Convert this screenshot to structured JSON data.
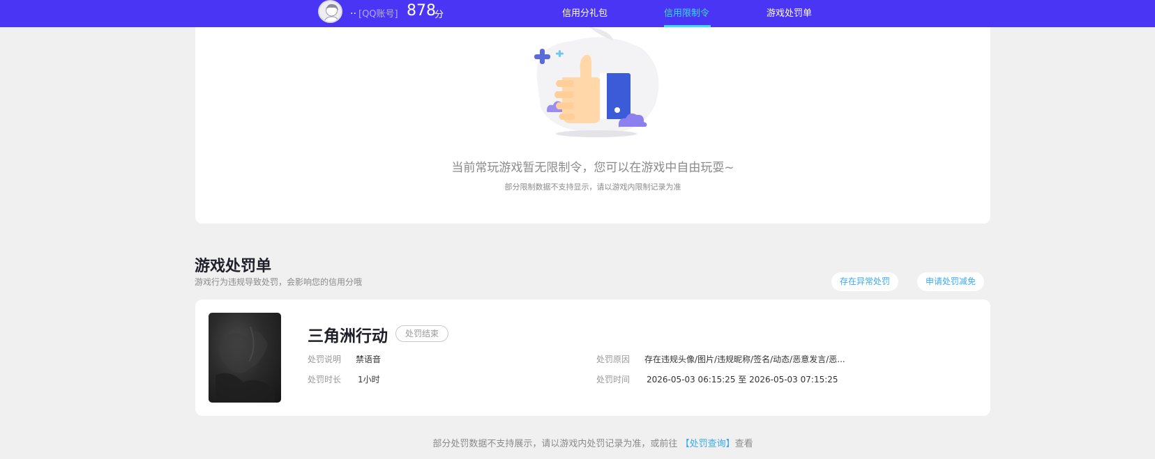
{
  "header": {
    "user_name": "..",
    "account_type": "[QQ账号]",
    "score": "878",
    "score_unit": "分",
    "nav": [
      {
        "label": "信用分礼包",
        "active": false
      },
      {
        "label": "信用限制令",
        "active": true
      },
      {
        "label": "游戏处罚单",
        "active": false
      }
    ]
  },
  "restriction": {
    "empty_title": "当前常玩游戏暂无限制令，您可以在游戏中自由玩耍~",
    "empty_note": "部分限制数据不支持显示，请以游戏内限制记录为准"
  },
  "penalty_section": {
    "title": "游戏处罚单",
    "subtitle": "游戏行为违规导致处罚，会影响您的信用分哦",
    "actions": [
      "存在异常处罚",
      "申请处罚减免"
    ]
  },
  "penalties": [
    {
      "game": "三角洲行动",
      "status": "处罚结束",
      "desc_label": "处罚说明",
      "desc": "禁语音",
      "duration_label": "处罚时长",
      "duration": "1小时",
      "reason_label": "处罚原因",
      "reason": "存在违规头像/图片/违规昵称/签名/动态/恶意发言/恶...",
      "time_label": "处罚时间",
      "time": "2026-05-03 06:15:25 至 2026-05-03 07:15:25"
    }
  ],
  "footer": {
    "note_prefix": "部分处罚数据不支持展示，请以游戏内处罚记录为准，或前往",
    "link": "【处罚查询】",
    "note_suffix": "查看"
  },
  "colors": {
    "topbar": "#4b35f5",
    "active_nav": "#35dcff",
    "link": "#3aaaf0",
    "page_bg": "#f0f0f0"
  },
  "icons": [
    "user-avatar",
    "thumbs-up-illustration",
    "game-cover-art"
  ]
}
